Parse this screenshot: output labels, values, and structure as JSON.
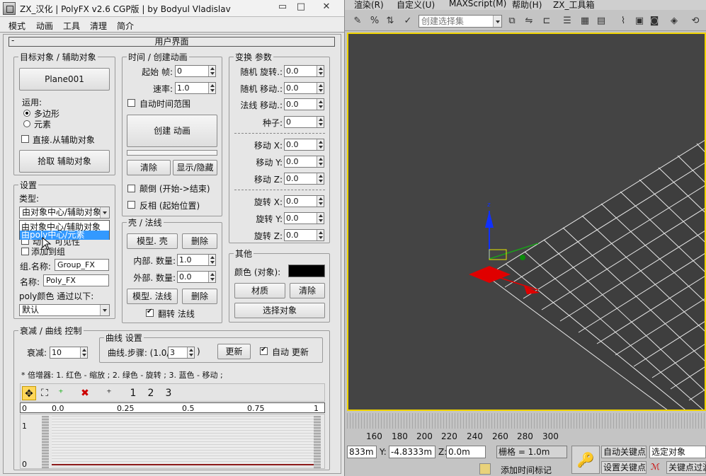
{
  "window": {
    "title": "ZX_汉化 | PolyFX v2.6 CGP版 | by Bodyul Vladislav",
    "minimize": "▭",
    "maximize": "□",
    "close": "✕"
  },
  "menu": [
    "模式",
    "动画",
    "工具",
    "清理",
    "简介"
  ],
  "rollout": {
    "minus": "-",
    "title": "用户界面"
  },
  "target_group": {
    "label": "目标对象 / 辅助对象",
    "object_button": "Plane001",
    "apply_label": "运用:",
    "radio_polygon": "多边形",
    "radio_element": "元素",
    "direct_helper": "直接.从辅助对象",
    "pick_button": "拾取 辅助对象"
  },
  "time_group": {
    "label": "时间 / 创建动画",
    "start_frame_label": "起始 帧:",
    "start_frame": "0",
    "speed_label": "速率:",
    "speed": "1.0",
    "auto_time": "自动时间范围",
    "create_button": "创建 动画",
    "clear_button": "清除",
    "showhide_button": "显示/隐藏",
    "reverse": "颠倒 (开始->结束)",
    "invert": "反相 (起始位置)"
  },
  "transform_group": {
    "label": "变换 参数",
    "rand_rot_label": "随机 旋转.:",
    "rand_rot": "0.0",
    "rand_move_label": "随机 移动.:",
    "rand_move": "0.0",
    "normal_move_label": "法线 移动.:",
    "normal_move": "0.0",
    "seed_label": "种子:",
    "seed": "0",
    "move_x_label": "移动 X:",
    "move_x": "0.0",
    "move_y_label": "移动 Y:",
    "move_y": "0.0",
    "move_z_label": "移动 Z:",
    "move_z": "0.0",
    "rot_x_label": "旋转 X:",
    "rot_x": "0.0",
    "rot_y_label": "旋转 Y:",
    "rot_y": "0.0",
    "rot_z_label": "旋转 Z:",
    "rot_z": "0.0"
  },
  "settings_group": {
    "label": "设置",
    "type_label": "类型:",
    "type_value": "由对象中心/辅助对象",
    "dropdown_options": [
      "由对象中心/辅助对象",
      "由poly中心/元素"
    ],
    "anim_partial": "动",
    "anim_partial2": "可见性",
    "add_group_partial": "添加到组",
    "group_name_label": "组.名称:",
    "group_name": "Group_FX",
    "name_label": "名称:",
    "name": "Poly_FX",
    "poly_color_label": "poly颜色 通过以下:",
    "poly_color_value": "默认"
  },
  "shell_group": {
    "label": "壳 / 法线",
    "model_shell": "模型. 壳",
    "delete1": "删除",
    "inner_label": "内部. 数量:",
    "inner": "1.0",
    "outer_label": "外部. 数量:",
    "outer": "0.0",
    "model_normal": "模型. 法线",
    "delete2": "删除",
    "flip_normal": "翻转 法线"
  },
  "other_group": {
    "label": "其他",
    "color_label": "颜色 (对象):",
    "color_hex": "#000000",
    "material": "材质",
    "clear": "清除",
    "select_objects": "选择对象"
  },
  "falloff_group": {
    "label": "衰减 / 曲线 控制",
    "falloff_label": "衰减:",
    "falloff": "10",
    "curve_settings_label": "曲线 设置",
    "curve_step_label": "曲线.步骤: (1.0/",
    "curve_step": "3",
    "curve_step_close": ")",
    "update_button": "更新",
    "auto_update": "自动 更新",
    "multiplier_note": "* 倍增器: 1. 红色 - 缩放 ; 2. 绿色 - 旋转 ; 3. 蓝色 - 移动 ;"
  },
  "curve_editor": {
    "tools": [
      "✥",
      "⛶",
      "⁺",
      "✖",
      "⁺",
      "1",
      "2",
      "3"
    ],
    "ruler": [
      "0",
      "0.0",
      "0.25",
      "0.5",
      "0.75",
      "1"
    ],
    "y_top": "1",
    "y_bottom": "0"
  },
  "max": {
    "menu": [
      "渲染(R)",
      "自定义(U)",
      "MAXScript(M)",
      "帮助(H)",
      "ZX_工具箱"
    ],
    "selection_set_placeholder": "创建选择集",
    "timeline_labels": [
      "160",
      "180",
      "200",
      "220",
      "240",
      "260",
      "280",
      "300"
    ],
    "x_value": "833m",
    "y_label": "Y:",
    "y_value": "-4.8333m",
    "z_label": "Z:",
    "z_value": "0.0m",
    "grid": "栅格 = 1.0m",
    "auto_key": "自动关键点",
    "selected_objects": "选定对象",
    "set_key": "设置关键点",
    "key_filter": "关键点过滤",
    "add_time_tag": "添加时间标记",
    "key_icon": "🔑"
  },
  "colors": {
    "viewport_bg": "#444444",
    "viewport_border": "#f0d400",
    "selection_blue": "#3399ff",
    "curve_red": "#8b1a1a"
  }
}
